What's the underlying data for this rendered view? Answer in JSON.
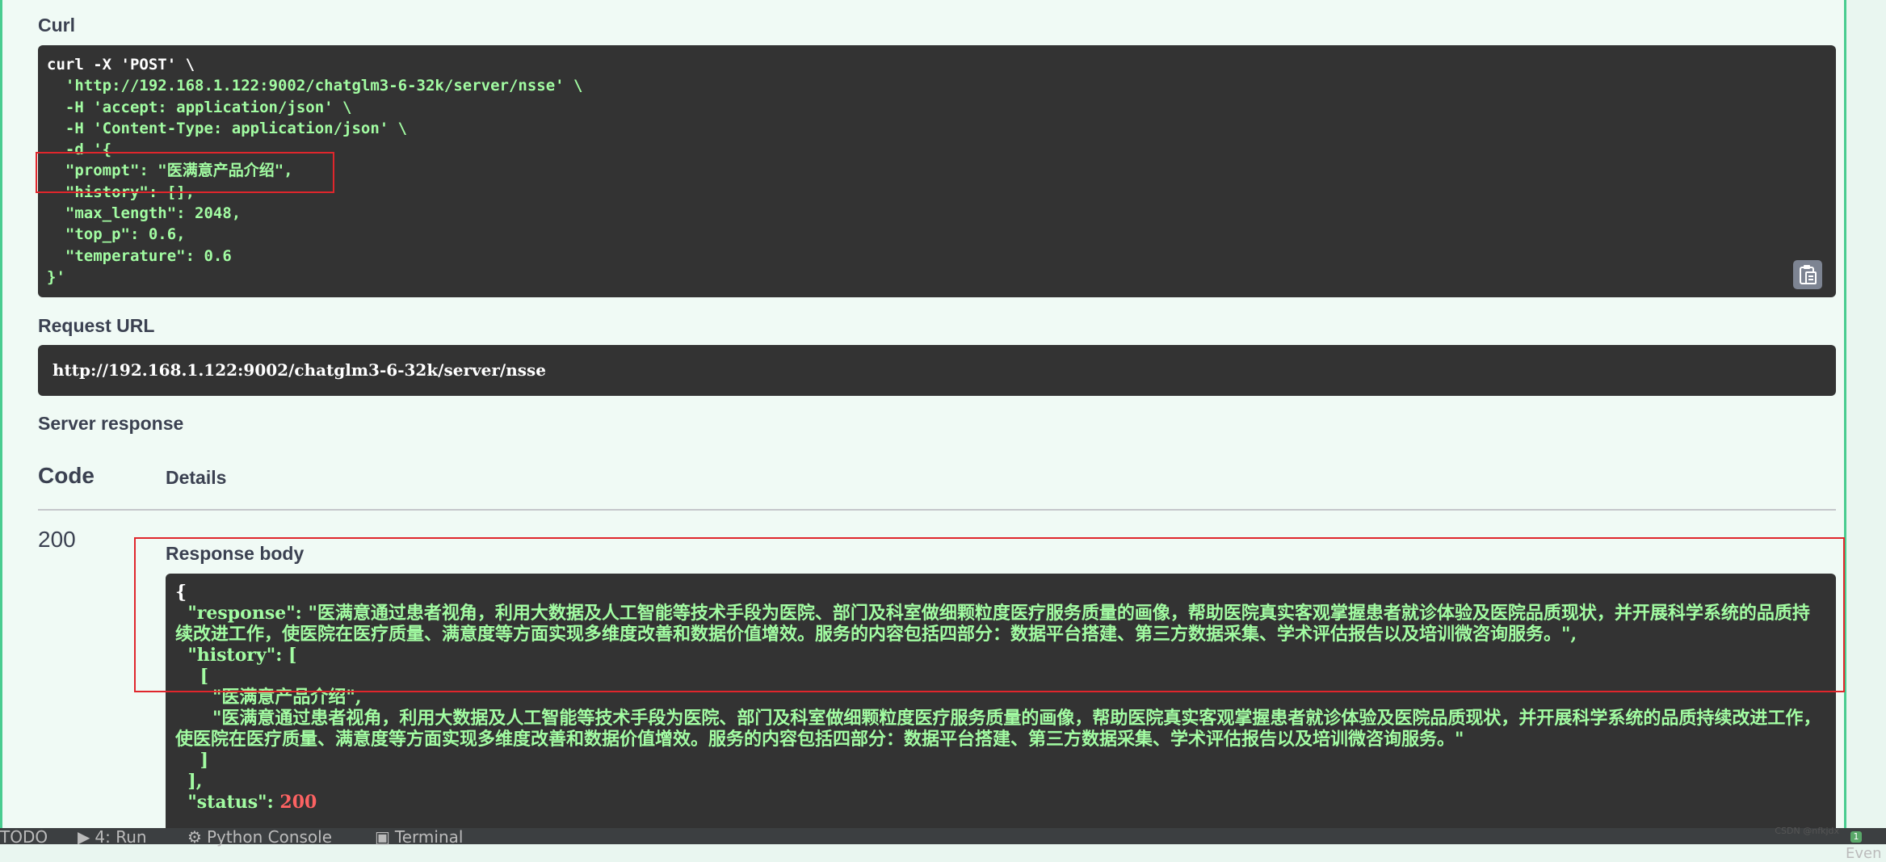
{
  "curl": {
    "title": "Curl",
    "lines": [
      "curl -X 'POST' \\",
      "  'http://192.168.1.122:9002/chatglm3-6-32k/server/nsse' \\",
      "  -H 'accept: application/json' \\",
      "  -H 'Content-Type: application/json' \\",
      "  -d '{",
      "  \"prompt\": \"医满意产品介绍\",",
      "  \"history\": [],",
      "  \"max_length\": 2048,",
      "  \"top_p\": 0.6,",
      "  \"temperature\": 0.6",
      "}'"
    ]
  },
  "request_url": {
    "title": "Request URL",
    "value": "http://192.168.1.122:9002/chatglm3-6-32k/server/nsse"
  },
  "server_response": {
    "title": "Server response",
    "code_header": "Code",
    "details_header": "Details",
    "code": "200",
    "body_title": "Response body",
    "body_lines": [
      "{",
      "  \"response\": \"医满意通过患者视角，利用大数据及人工智能等技术手段为医院、部门及科室做细颗粒度医疗服务质量的画像，帮助医院真实客观掌握患者就诊体验及医院品质现状，并开展科学系统的品质持续改进工作，使医院在医疗质量、满意度等方面实现多维度改善和数据价值增效。服务的内容包括四部分：数据平台搭建、第三方数据采集、学术评估报告以及培训微咨询服务。\",",
      "  \"history\": [",
      "    [",
      "      \"医满意产品介绍\",",
      "      \"医满意通过患者视角，利用大数据及人工智能等技术手段为医院、部门及科室做细颗粒度医疗服务质量的画像，帮助医院真实客观掌握患者就诊体验及医院品质现状，并开展科学系统的品质持续改进工作，使医院在医疗质量、满意度等方面实现多维度改善和数据价值增效。服务的内容包括四部分：数据平台搭建、第三方数据采集、学术评估报告以及培训微咨询服务。\"",
      "    ]",
      "  ],"
    ],
    "status_key": "  \"status\": ",
    "status_value": "200"
  },
  "bottom_bar": {
    "todo": "TODO",
    "run": "4: Run",
    "python_console": "Python Console",
    "terminal": "Terminal",
    "event": "Even"
  },
  "watermark": "CSDN @nfkjdx",
  "colors": {
    "panel_border": "#49cc90",
    "code_bg": "#333333",
    "string_green": "#a2fca2",
    "highlight_red": "#e0262c"
  }
}
